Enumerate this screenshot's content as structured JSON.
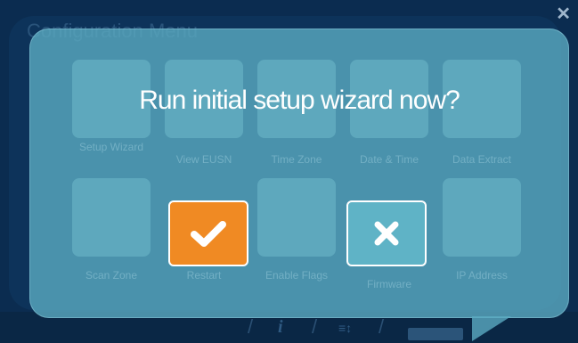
{
  "background": {
    "title": "Configuration Menu",
    "close_glyph": "✕"
  },
  "tiles": [
    {
      "label": "Setup Wizard"
    },
    {
      "label": "View EUSN"
    },
    {
      "label": "Time Zone"
    },
    {
      "label": "Date & Time"
    },
    {
      "label": "Data Extract"
    },
    {
      "label": "Scan Zone"
    },
    {
      "label": "Restart"
    },
    {
      "label": "Enable Flags"
    },
    {
      "label": "Firmware"
    },
    {
      "label": "IP Address"
    }
  ],
  "dialog": {
    "question": "Run initial setup wizard now?",
    "confirm_icon": "checkmark-icon",
    "cancel_icon": "x-icon"
  },
  "bottom_bar": {
    "info_glyph": "i",
    "sort_glyph": "≡↕"
  },
  "colors": {
    "confirm_button": "#f08a23",
    "cancel_button": "#5fb3c6",
    "dialog": "#5aaac0",
    "background": "#0b2c50"
  }
}
